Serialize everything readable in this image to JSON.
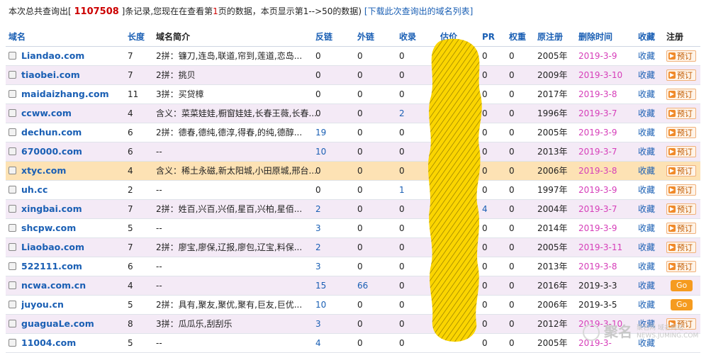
{
  "summary": {
    "prefix": "本次总共查询出[ ",
    "count": "1107508",
    "mid": " ]条记录,您现在在查看第",
    "page": "1",
    "suffix": "页的数据，本页显示第1-->50的数据)",
    "download_link": "[下载此次查询出的域名列表]"
  },
  "headers": {
    "name": "域名",
    "length": "长度",
    "intro": "域名简介",
    "backlinks": "反链",
    "external": "外链",
    "indexed": "收录",
    "estimate": "估价",
    "pr": "PR",
    "weight": "权重",
    "registered": "原注册",
    "delete_time": "删除时间",
    "favorite": "收藏",
    "register": "注册"
  },
  "colors": {
    "link": "#1a5fb4",
    "delete_date": "#d63eb9",
    "count": "#cc0000",
    "row_alt": "#f4eaf6",
    "row_highlight": "#fde2b4",
    "go_button": "#f59b1f",
    "preorder_button": "#f08a2a"
  },
  "rows": [
    {
      "name": "Liandao.com",
      "length": "7",
      "intro": "2拼：镰刀,连岛,联道,帘到,莲道,恋岛...",
      "backlinks": "0",
      "external": "0",
      "indexed": "0",
      "estimate": "",
      "pr": "0",
      "weight": "0",
      "registered": "2005年",
      "delete_time": "2019-3-9",
      "favorite": "收藏",
      "action": "预订",
      "action_type": "preorder",
      "del_color": "pink",
      "style": "normal"
    },
    {
      "name": "tiaobei.com",
      "length": "7",
      "intro": "2拼：挑贝",
      "backlinks": "0",
      "external": "0",
      "indexed": "0",
      "estimate": "",
      "pr": "0",
      "weight": "0",
      "registered": "2009年",
      "delete_time": "2019-3-10",
      "favorite": "收藏",
      "action": "预订",
      "action_type": "preorder",
      "del_color": "pink",
      "style": "alt"
    },
    {
      "name": "maidaizhang.com",
      "length": "11",
      "intro": "3拼：买贷樟",
      "backlinks": "0",
      "external": "0",
      "indexed": "0",
      "estimate": "",
      "pr": "0",
      "weight": "0",
      "registered": "2017年",
      "delete_time": "2019-3-8",
      "favorite": "收藏",
      "action": "预订",
      "action_type": "preorder",
      "del_color": "pink",
      "style": "normal"
    },
    {
      "name": "ccww.com",
      "length": "4",
      "intro": "含义：菜菜娃娃,橱窗娃娃,长春王薇,长春...",
      "backlinks": "0",
      "external": "0",
      "indexed": "2",
      "estimate": "",
      "pr": "0",
      "weight": "0",
      "registered": "1996年",
      "delete_time": "2019-3-7",
      "favorite": "收藏",
      "action": "预订",
      "action_type": "preorder",
      "del_color": "pink",
      "style": "alt"
    },
    {
      "name": "dechun.com",
      "length": "6",
      "intro": "2拼：德春,德纯,德淳,得春,的纯,德醇...",
      "backlinks": "19",
      "external": "0",
      "indexed": "0",
      "estimate": "",
      "pr": "0",
      "weight": "0",
      "registered": "2005年",
      "delete_time": "2019-3-9",
      "favorite": "收藏",
      "action": "预订",
      "action_type": "preorder",
      "del_color": "pink",
      "style": "normal"
    },
    {
      "name": "670000.com",
      "length": "6",
      "intro": "--",
      "backlinks": "10",
      "external": "0",
      "indexed": "0",
      "estimate": "",
      "pr": "0",
      "weight": "0",
      "registered": "2013年",
      "delete_time": "2019-3-7",
      "favorite": "收藏",
      "action": "预订",
      "action_type": "preorder",
      "del_color": "pink",
      "style": "alt"
    },
    {
      "name": "xtyc.com",
      "length": "4",
      "intro": "含义：稀土永磁,新太阳城,小田原城,邢台...",
      "backlinks": "0",
      "external": "0",
      "indexed": "0",
      "estimate": "",
      "pr": "0",
      "weight": "0",
      "registered": "2006年",
      "delete_time": "2019-3-8",
      "favorite": "收藏",
      "action": "预订",
      "action_type": "preorder",
      "del_color": "pink",
      "style": "highlight"
    },
    {
      "name": "uh.cc",
      "length": "2",
      "intro": "--",
      "backlinks": "0",
      "external": "0",
      "indexed": "1",
      "estimate": "",
      "pr": "0",
      "weight": "0",
      "registered": "1997年",
      "delete_time": "2019-3-9",
      "favorite": "收藏",
      "action": "预订",
      "action_type": "preorder",
      "del_color": "pink",
      "style": "normal"
    },
    {
      "name": "xingbai.com",
      "length": "7",
      "intro": "2拼：姓百,兴百,兴佰,星百,兴柏,星佰...",
      "backlinks": "2",
      "external": "0",
      "indexed": "0",
      "estimate": "",
      "pr": "4",
      "weight": "0",
      "registered": "2004年",
      "delete_time": "2019-3-7",
      "favorite": "收藏",
      "action": "预订",
      "action_type": "preorder",
      "del_color": "pink",
      "style": "alt"
    },
    {
      "name": "shcpw.com",
      "length": "5",
      "intro": "--",
      "backlinks": "3",
      "external": "0",
      "indexed": "0",
      "estimate": "",
      "pr": "0",
      "weight": "0",
      "registered": "2014年",
      "delete_time": "2019-3-9",
      "favorite": "收藏",
      "action": "预订",
      "action_type": "preorder",
      "del_color": "pink",
      "style": "normal"
    },
    {
      "name": "Liaobao.com",
      "length": "7",
      "intro": "2拼：廖宝,廖保,辽报,廖包,辽宝,料保...",
      "backlinks": "2",
      "external": "0",
      "indexed": "0",
      "estimate": "",
      "pr": "0",
      "weight": "0",
      "registered": "2005年",
      "delete_time": "2019-3-11",
      "favorite": "收藏",
      "action": "预订",
      "action_type": "preorder",
      "del_color": "pink",
      "style": "alt"
    },
    {
      "name": "522111.com",
      "length": "6",
      "intro": "--",
      "backlinks": "3",
      "external": "0",
      "indexed": "0",
      "estimate": "",
      "pr": "0",
      "weight": "0",
      "registered": "2013年",
      "delete_time": "2019-3-8",
      "favorite": "收藏",
      "action": "预订",
      "action_type": "preorder",
      "del_color": "pink",
      "style": "normal"
    },
    {
      "name": "ncwa.com.cn",
      "length": "4",
      "intro": "--",
      "backlinks": "15",
      "external": "66",
      "indexed": "0",
      "estimate": "",
      "pr": "0",
      "weight": "0",
      "registered": "2016年",
      "delete_time": "2019-3-3",
      "favorite": "收藏",
      "action": "Go",
      "action_type": "go",
      "del_color": "black",
      "style": "alt"
    },
    {
      "name": "juyou.cn",
      "length": "5",
      "intro": "2拼：具有,聚友,聚优,聚有,巨友,巨优...",
      "backlinks": "10",
      "external": "0",
      "indexed": "0",
      "estimate": "",
      "pr": "0",
      "weight": "0",
      "registered": "2006年",
      "delete_time": "2019-3-5",
      "favorite": "收藏",
      "action": "Go",
      "action_type": "go",
      "del_color": "black",
      "style": "normal"
    },
    {
      "name": "guaguaLe.com",
      "length": "8",
      "intro": "3拼：瓜瓜乐,刮刮乐",
      "backlinks": "3",
      "external": "0",
      "indexed": "0",
      "estimate": "",
      "pr": "0",
      "weight": "0",
      "registered": "2012年",
      "delete_time": "2019-3-10",
      "favorite": "收藏",
      "action": "预订",
      "action_type": "preorder",
      "del_color": "pink",
      "style": "alt"
    },
    {
      "name": "11004.com",
      "length": "5",
      "intro": "--",
      "backlinks": "4",
      "external": "0",
      "indexed": "0",
      "estimate": "",
      "pr": "0",
      "weight": "0",
      "registered": "2005年",
      "delete_time": "2019-3-",
      "favorite": "收藏",
      "action": "",
      "action_type": "none",
      "del_color": "pink",
      "style": "normal"
    }
  ],
  "watermark": {
    "brand": "聚名",
    "line1": "聚名网 域名网站",
    "line2": "NEWS.JUMING.COM"
  }
}
